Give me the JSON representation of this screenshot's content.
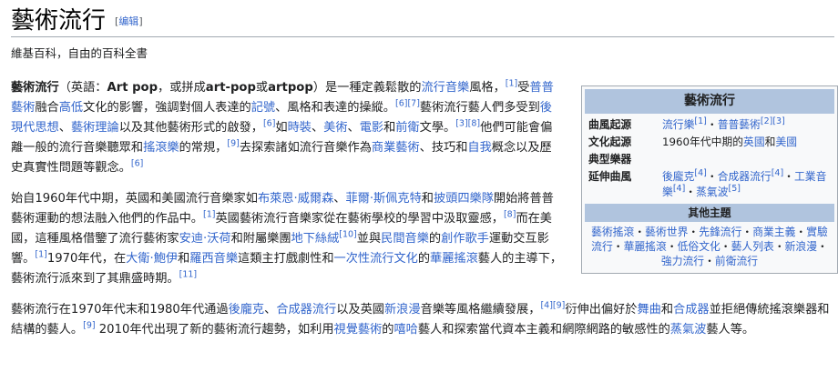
{
  "header": {
    "title": "藝術流行",
    "edit_label": "编辑",
    "subtitle": "維基百科，自由的百科全書"
  },
  "paragraph1": {
    "t1": "藝術流行",
    "t2": "（英語：",
    "t3": "Art pop",
    "t4": "，或拼成",
    "t5": "art-pop",
    "t6": "或",
    "t7": "artpop",
    "t8": "）是一種定義鬆散的",
    "l_popmusic": "流行音樂",
    "t9": "風格，",
    "r1": "[1]",
    "t10": "受",
    "l_popart": "普普藝術",
    "t11": "融合",
    "l_high": "高低",
    "t12": "文化的影響，強調對個人表達的",
    "l_semiotics": "記號",
    "t13": "、風格和表達的操縱。",
    "r67": "[6][7]",
    "t14": "藝術流行藝人們多受到",
    "l_postmodern": "後現代思想",
    "t15": "、",
    "l_arttheory": "藝術理論",
    "t16": "以及其他藝術形式的啟發，",
    "r6a": "[6]",
    "t17": "如",
    "l_fashion": "時裝",
    "t18": "、",
    "l_art": "美術",
    "t19": "、",
    "l_film": "電影",
    "t20": "和",
    "l_avant": "前衛",
    "t21": "文學。",
    "r38": "[3][8]",
    "t22": "他們可能會偏離一般的流行音樂聽眾和",
    "l_rock": "搖滾樂",
    "t23": "的常規，",
    "r9": "[9]",
    "t24": "去探索諸如流行音樂作為",
    "l_commercial": "商業藝術",
    "t25": "、技巧和",
    "l_selfref": "自我",
    "t26": "概念以及歷史真實性問題等觀念。",
    "r6b": "[6]"
  },
  "paragraph2": {
    "t1": "始自1960年代中期，英國和美國流行音樂家如",
    "l_brian": "布萊恩·威爾森",
    "t2": "、",
    "l_phil": "菲爾·斯佩克特",
    "t3": "和",
    "l_beatles": "披頭四樂隊",
    "t4": "開始將普普藝術運動的想法融入他們的作品中。",
    "r1": "[1]",
    "t5": "英國藝術流行音樂家從在藝術學校的學習中汲取靈感，",
    "r8": "[8]",
    "t6": "而在美國，這種風格借鑒了流行藝術家",
    "l_warhol": "安迪·沃荷",
    "t7": "和附屬樂團",
    "l_velvet": "地下絲絨",
    "r10": "[10]",
    "t8": "並與",
    "l_folk": "民間音樂",
    "t9": "的",
    "l_singer": "創作歌手",
    "t10": "運動交互影響。",
    "r1b": "[1]",
    "t11": "1970年代，在",
    "l_bowie": "大衛·鮑伊",
    "t12": "和",
    "l_roxy": "羅西音樂",
    "t13": "這類主打戲劇性和",
    "l_onehit": "一次性流行文化",
    "t14": "的",
    "l_glam": "華麗搖滾",
    "t15": "藝人的主導下，藝術流行派來到了其鼎盛時期。",
    "r11": "[11]"
  },
  "paragraph3": {
    "t1": "藝術流行在1970年代末和1980年代通過",
    "l_postpunk": "後龐克",
    "t2": "、",
    "l_synthpop": "合成器流行",
    "t3": "以及英國",
    "l_newwave": "新浪漫",
    "t4": "音樂等風格繼續發展，",
    "r49": "[4][9]",
    "t5": "衍伸出偏好於",
    "l_dance": "舞曲",
    "t6": "和",
    "l_synth": "合成器",
    "t7": "並拒絕傳統搖滾樂器和結構的藝人。",
    "r9": "[9]",
    "t8": " 2010年代出現了新的藝術流行趨勢，如利用",
    "l_visual": "視覺藝術",
    "t9": "的",
    "l_hiphop": "嘻哈",
    "t10": "藝人和探索當代資本主義和網際網路的敏感性的",
    "l_vaporwave": "蒸氣波",
    "t11": "藝人等。"
  },
  "infobox": {
    "title": "藝術流行",
    "origin_label": "曲風起源",
    "origin_v1": "流行樂",
    "origin_r1": "[1]",
    "origin_sep": "・",
    "origin_v2": "普普藝術",
    "origin_r2": "[2][3]",
    "culture_label": "文化起源",
    "culture_t1": "1960年代中期的",
    "culture_l1": "英國",
    "culture_t2": "和",
    "culture_l2": "美國",
    "instruments_label": "典型樂器",
    "derived_label": "延伸曲風",
    "derived_v1": "後龐克",
    "derived_r1": "[4]",
    "derived_sep1": "・",
    "derived_v2": "合成器流行",
    "derived_r2": "[4]",
    "derived_sep2": "・",
    "derived_v3": "工業音樂",
    "derived_r3": "[4]",
    "derived_sep3": "・",
    "derived_v4": "蒸氣波",
    "derived_r4": "[5]",
    "other_label": "其他主題",
    "topics": [
      "藝術搖滾",
      "藝術世界",
      "先鋒流行",
      "商業主義",
      "實驗流行",
      "華麗搖滾",
      "低俗文化",
      "藝人列表",
      "新浪漫",
      "強力流行",
      "前衛流行"
    ],
    "topic_sep": "・"
  }
}
